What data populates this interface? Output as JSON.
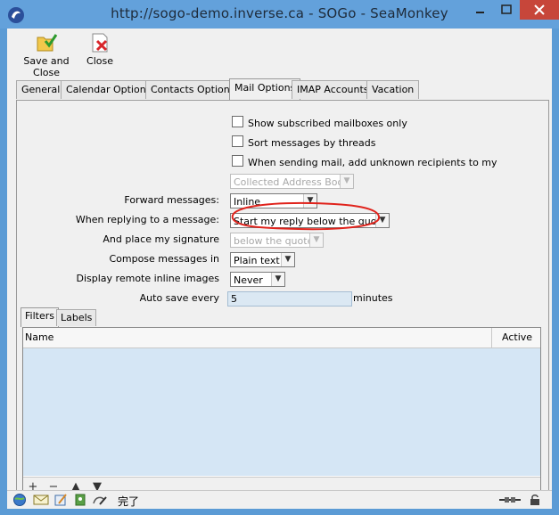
{
  "window": {
    "title": "http://sogo-demo.inverse.ca - SOGo - SeaMonkey",
    "accent_color": "#63a1db",
    "close_color": "#c7463a"
  },
  "toolbar": {
    "save_and_close": "Save and Close",
    "close": "Close"
  },
  "tabs": [
    {
      "label": "General"
    },
    {
      "label": "Calendar Options"
    },
    {
      "label": "Contacts Options"
    },
    {
      "label": "Mail Options"
    },
    {
      "label": "IMAP Accounts"
    },
    {
      "label": "Vacation"
    }
  ],
  "active_tab": "Mail Options",
  "mail_options": {
    "show_subscribed_only": {
      "label": "Show subscribed mailboxes only",
      "checked": false
    },
    "sort_by_threads": {
      "label": "Sort messages by threads",
      "checked": false
    },
    "add_unknown_recipients": {
      "label": "When sending mail, add unknown recipients to my",
      "checked": false
    },
    "address_book": {
      "value": "Collected Address Book",
      "disabled": true
    },
    "forward_messages": {
      "label": "Forward messages:",
      "value": "Inline"
    },
    "reply_position": {
      "label": "When replying to a message:",
      "value": "Start my reply below the quote"
    },
    "signature_position": {
      "label": "And place my signature",
      "value": "below the quote",
      "disabled": true
    },
    "compose_format": {
      "label": "Compose messages in",
      "value": "Plain text"
    },
    "remote_images": {
      "label": "Display remote inline images",
      "value": "Never"
    },
    "auto_save": {
      "label": "Auto save every",
      "value": "5",
      "unit": "minutes"
    }
  },
  "subtabs": [
    {
      "label": "Filters"
    },
    {
      "label": "Labels"
    }
  ],
  "filters_table": {
    "columns": [
      "Name",
      "Active"
    ],
    "rows": [],
    "buttons": [
      "+",
      "−",
      "▲",
      "▼"
    ]
  },
  "statusbar": {
    "text": "完了"
  },
  "annotation_color": "#e0231c"
}
